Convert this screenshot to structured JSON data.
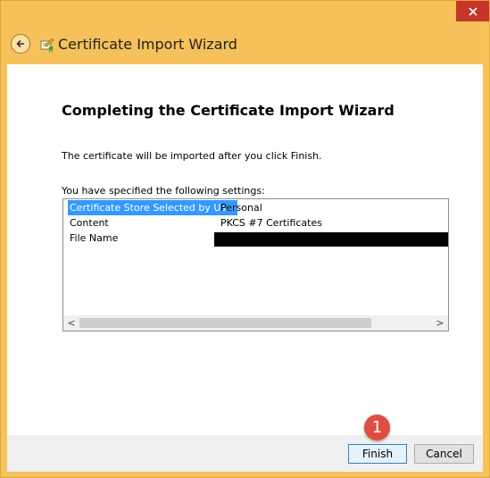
{
  "window": {
    "close_glyph": "✕"
  },
  "header": {
    "title": "Certificate Import Wizard",
    "back_icon": "back-arrow-icon",
    "wizard_icon": "certificate-icon"
  },
  "main": {
    "heading": "Completing the Certificate Import Wizard",
    "description": "The certificate will be imported after you click Finish.",
    "settings_label": "You have specified the following settings:",
    "settings": [
      {
        "key": "Certificate Store Selected by User",
        "value": "Personal",
        "selected": true
      },
      {
        "key": "Content",
        "value": "PKCS #7 Certificates",
        "selected": false
      },
      {
        "key": "File Name",
        "value": "",
        "redacted": true,
        "selected": false
      }
    ],
    "scroll_left_glyph": "<",
    "scroll_right_glyph": ">"
  },
  "footer": {
    "finish_label": "Finish",
    "cancel_label": "Cancel"
  },
  "annotation": {
    "marker_number": "1",
    "marker_color": "#e04e43"
  },
  "colors": {
    "title_bar": "#f6c15b",
    "close_button": "#c5352a",
    "selection": "#3399ff"
  }
}
